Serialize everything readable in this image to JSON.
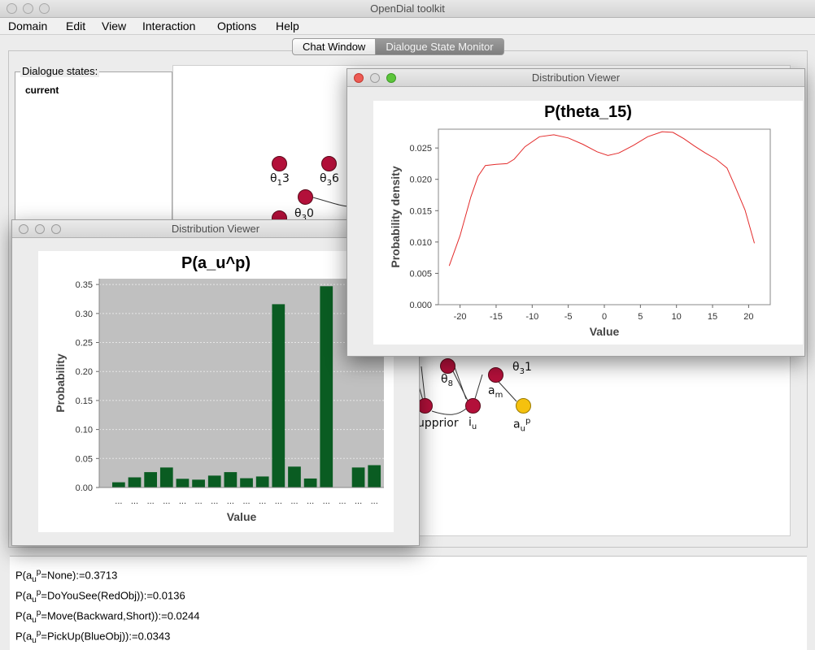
{
  "app": {
    "title": "OpenDial toolkit"
  },
  "menu": [
    "Domain",
    "Edit",
    "View",
    "Interaction",
    "Options",
    "Help"
  ],
  "tabs": {
    "chat": "Chat Window",
    "monitor": "Dialogue State Monitor"
  },
  "states_panel": {
    "label": "Dialogue states:",
    "current": "current"
  },
  "nodes": [
    {
      "base": "θ",
      "sub": "1",
      "tail": "3"
    },
    {
      "base": "θ",
      "sub": "3",
      "tail": "6"
    },
    {
      "base": "θ",
      "sub": "3",
      "tail": "0"
    },
    {
      "base": "θ",
      "sub": "8",
      "tail": ""
    },
    {
      "base": "θ",
      "sub": "3",
      "tail": "1"
    },
    {
      "base": "a",
      "sub": "m",
      "tail": ""
    },
    {
      "base": "i",
      "sub": "u",
      "tail": ""
    },
    {
      "base": "a",
      "sub": "u",
      "sup": "p"
    },
    {
      "text": "upprior"
    }
  ],
  "viewer_top": {
    "window_title": "Distribution Viewer",
    "chart_data": {
      "type": "line",
      "title": "P(theta_15)",
      "xlabel": "Value",
      "ylabel": "Probability density",
      "xlim": [
        -23,
        23
      ],
      "ylim": [
        0,
        0.028
      ],
      "xticks": [
        -20,
        -15,
        -10,
        -5,
        0,
        5,
        10,
        15,
        20
      ],
      "yticks": [
        "0.000",
        "0.005",
        "0.010",
        "0.015",
        "0.020",
        "0.025"
      ],
      "x": [
        -21.5,
        -20,
        -18.5,
        -17.5,
        -16.5,
        -15,
        -13.5,
        -12.5,
        -11,
        -9,
        -7,
        -5,
        -3,
        -1,
        0.5,
        2,
        4,
        6,
        8,
        9.5,
        11,
        12.5,
        14,
        15.5,
        17,
        18,
        19.5,
        20.8
      ],
      "y": [
        0.0062,
        0.011,
        0.0172,
        0.0205,
        0.0222,
        0.0224,
        0.0225,
        0.0232,
        0.0252,
        0.0268,
        0.0271,
        0.0266,
        0.0256,
        0.0244,
        0.0238,
        0.0242,
        0.0254,
        0.0268,
        0.0276,
        0.0275,
        0.0265,
        0.0253,
        0.0242,
        0.0232,
        0.0218,
        0.0192,
        0.0151,
        0.0098
      ],
      "grid": false,
      "line_color": "#e32b2b"
    }
  },
  "viewer_bottom": {
    "window_title": "Distribution Viewer",
    "chart_data": {
      "type": "bar",
      "title": "P(a_u^p)",
      "xlabel": "Value",
      "ylabel": "Probability",
      "ylim": [
        0,
        0.36
      ],
      "yticks": [
        "0.00",
        "0.05",
        "0.10",
        "0.15",
        "0.20",
        "0.25",
        "0.30",
        "0.35"
      ],
      "categories": [
        "...",
        "...",
        "...",
        "...",
        "...",
        "...",
        "...",
        "...",
        "...",
        "...",
        "...",
        "...",
        "...",
        "...",
        "...",
        "...",
        "..."
      ],
      "values": [
        0.009,
        0.0175,
        0.0265,
        0.0345,
        0.015,
        0.0135,
        0.0205,
        0.0265,
        0.016,
        0.019,
        0.316,
        0.036,
        0.0155,
        0.347,
        0.0,
        0.0345,
        0.0385
      ],
      "bar_color": "#0a5c22",
      "plot_bg": "#c0c0c0",
      "grid": true
    }
  },
  "output_lines": [
    {
      "pre": "P(a",
      "sub": "u",
      "sup": "p",
      "post": "=None):=0.3713"
    },
    {
      "pre": "P(a",
      "sub": "u",
      "sup": "p",
      "post": "=DoYouSee(RedObj)):=0.0136"
    },
    {
      "pre": "P(a",
      "sub": "u",
      "sup": "p",
      "post": "=Move(Backward,Short)):=0.0244"
    },
    {
      "pre": "P(a",
      "sub": "u",
      "sup": "p",
      "post": "=PickUp(BlueObj)):=0.0343"
    }
  ]
}
